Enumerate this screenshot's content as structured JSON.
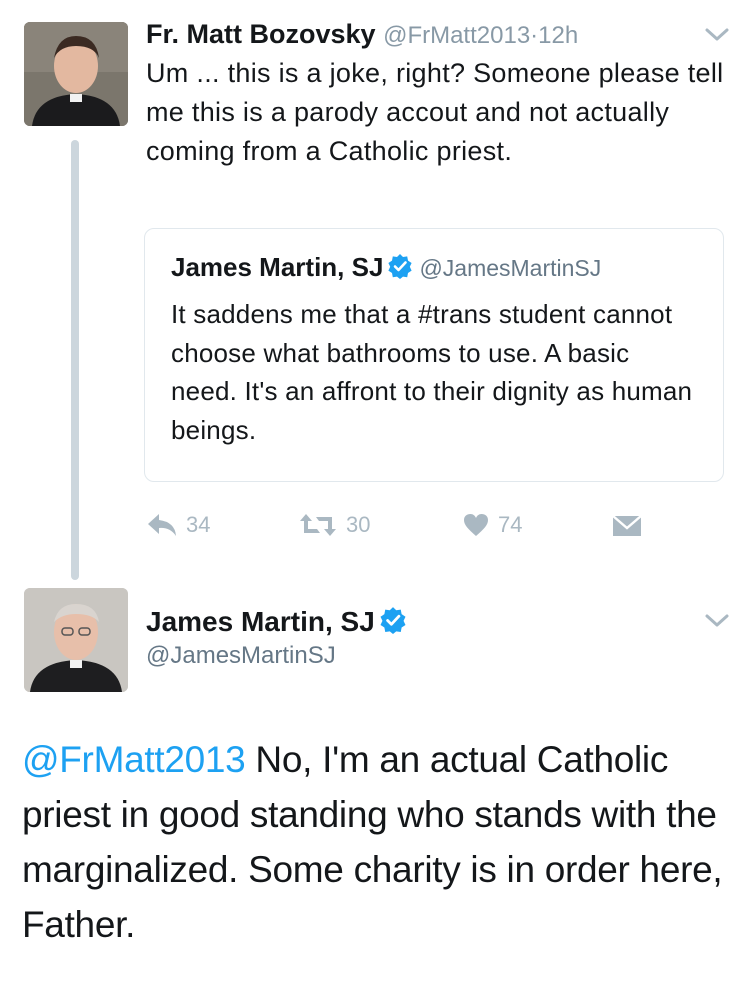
{
  "tweet1": {
    "author_name": "Fr. Matt Bozovsky",
    "author_handle": "@FrMatt2013",
    "separator": "·",
    "time": "12h",
    "text": "Um ... this is a joke, right? Someone please tell me this is a parody accout and not actually coming from a Catholic priest.",
    "quoted": {
      "author_name": "James Martin, SJ",
      "author_handle": "@JamesMartinSJ",
      "text": "It saddens me that a #trans student cannot choose what bathrooms to use. A basic need. It's an affront to their dignity as human beings."
    },
    "actions": {
      "reply_count": "34",
      "retweet_count": "30",
      "like_count": "74"
    }
  },
  "tweet2": {
    "author_name": "James Martin, SJ",
    "author_handle": "@JamesMartinSJ",
    "mention": "@FrMatt2013",
    "text": " No, I'm an actual Catholic priest in good standing who stands with the marginalized. Some charity is in order here, Father."
  },
  "colors": {
    "link_blue": "#1da1f2",
    "verified_blue": "#1da1f2",
    "muted_gray": "#8899a6",
    "icon_gray": "#aab8c2",
    "thread_line": "#ccd6dd"
  },
  "icons": {
    "caret": "chevron-down-icon",
    "verified": "verified-badge-icon",
    "reply": "reply-icon",
    "retweet": "retweet-icon",
    "like": "heart-icon",
    "dm": "envelope-icon"
  }
}
